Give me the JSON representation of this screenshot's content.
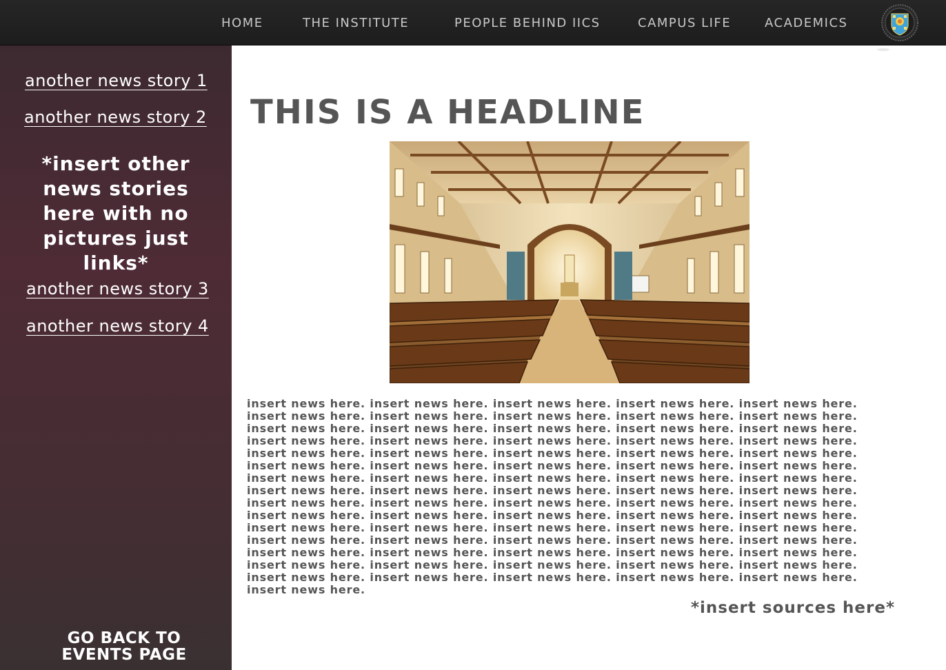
{
  "nav": {
    "items": [
      {
        "label": "HOME"
      },
      {
        "label": "THE INSTITUTE"
      },
      {
        "label": "PEOPLE BEHIND IICS"
      },
      {
        "label": "CAMPUS LIFE"
      },
      {
        "label": "ACADEMICS"
      }
    ],
    "logo_icon": "university-seal-icon"
  },
  "sidebar": {
    "links": [
      {
        "label": "another news story 1"
      },
      {
        "label": "another news story 2"
      },
      {
        "label": "another news story 3"
      },
      {
        "label": "another news story 4"
      }
    ],
    "note": "*insert other news stories here with no pictures just links*",
    "back_label_line1": "GO BACK TO",
    "back_label_line2": "EVENTS PAGE"
  },
  "article": {
    "headline": "THIS IS A HEADLINE",
    "image_icon": "church-interior-photo",
    "body": "insert news here. insert news here. insert news here. insert news here. insert news here. insert news here. insert news here. insert news here. insert news here. insert news here. insert news here. insert news here. insert news here. insert news here. insert news here. insert news here. insert news here. insert news here. insert news here. insert news here. insert news here. insert news here. insert news here. insert news here. insert news here. insert news here. insert news here. insert news here. insert news here. insert news here. insert news here. insert news here. insert news here. insert news here. insert news here. insert news here. insert news here. insert news here. insert news here. insert news here. insert news here. insert news here. insert news here. insert news here. insert news here. insert news here. insert news here. insert news here. insert news here. insert news here. insert news here. insert news here. insert news here. insert news here. insert news here. insert news here. insert news here. insert news here. insert news here. insert news here. insert news here. insert news here. insert news here. insert news here. insert news here. insert news here. insert news here. insert news here. insert news here. insert news here. insert news here. insert news here. insert news here. insert news here. insert news here. insert news here.",
    "sources": "*insert sources here*"
  },
  "colors": {
    "topbar": "#222222",
    "nav_text": "#c9c9c9",
    "sidebar": "#4e2b35",
    "headline": "#555555"
  }
}
